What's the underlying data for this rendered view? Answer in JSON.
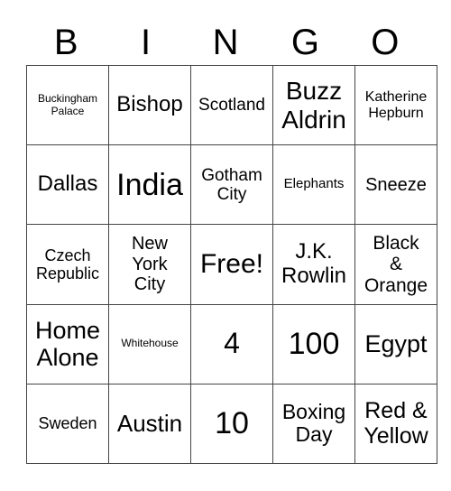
{
  "header": [
    "B",
    "I",
    "N",
    "G",
    "O"
  ],
  "rows": [
    [
      "Buckingham\nPalace",
      "Bishop",
      "Scotland",
      "Buzz\nAldrin",
      "Katherine\nHepburn"
    ],
    [
      "Dallas",
      "India",
      "Gotham\nCity",
      "Elephants",
      "Sneeze"
    ],
    [
      "Czech\nRepublic",
      "New\nYork\nCity",
      "Free!",
      "J.K.\nRowlin",
      "Black\n&\nOrange"
    ],
    [
      "Home\nAlone",
      "Whitehouse",
      "4",
      "100",
      "Egypt"
    ],
    [
      "Sweden",
      "Austin",
      "10",
      "Boxing\nDay",
      "Red &\nYellow"
    ]
  ]
}
